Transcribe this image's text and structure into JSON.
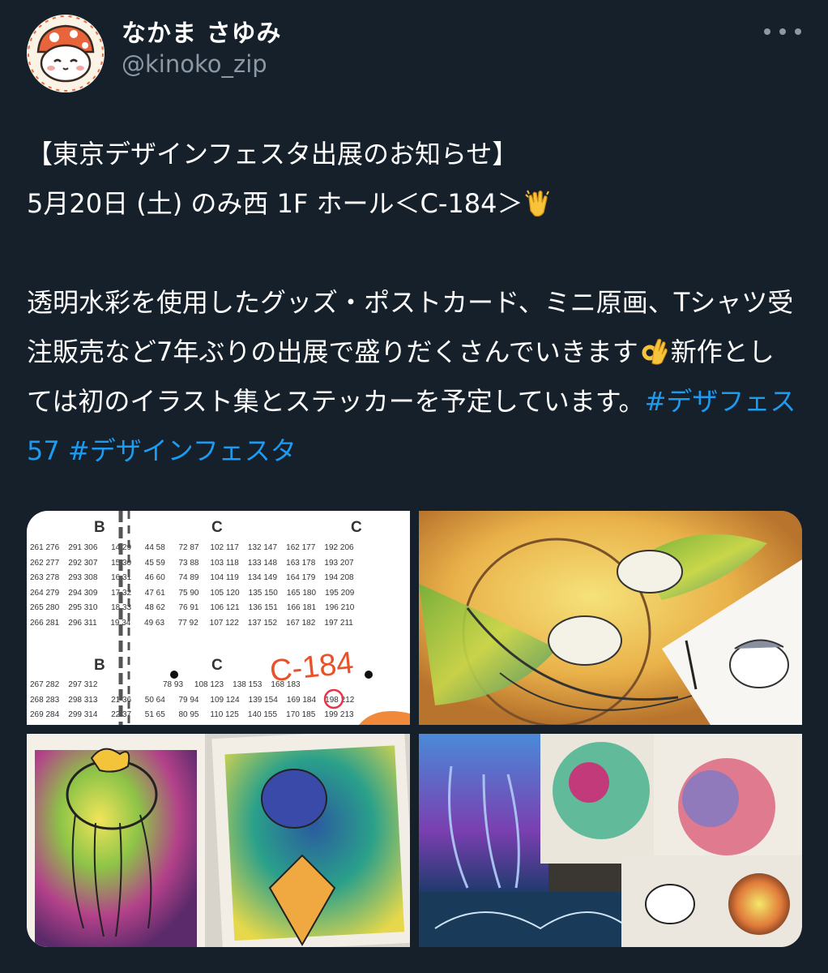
{
  "author": {
    "display_name": "なかま さゆみ",
    "handle": "@kinoko_zip",
    "avatar_icon": "mushroom-character-avatar"
  },
  "menu_icon": "more-options-icon",
  "tweet": {
    "line1": "【東京デザインフェスタ出展のお知らせ】",
    "line2": " 5月20日 (土) のみ西 1F ホール＜C-184＞",
    "line2_emoji": "clapping-hands-emoji",
    "para2_part1": "透明水彩を使用したグッズ・ポストカード、ミニ原画、Tシャツ受注販売など7年ぶりの出展で盛りだくさんでいきます",
    "para2_emoji": "ok-hand-emoji",
    "para2_part2": "新作としては初のイラスト集とステッカーを予定しています。",
    "hashtag1": "#デザフェス57",
    "hashtag2": "#デザインフェスタ"
  },
  "media": {
    "floor_map": {
      "section_labels": [
        "B",
        "C",
        "C",
        "B",
        "C"
      ],
      "booth_marker": "C-184",
      "rows_top": [
        "261 276    291 306      14 29      44 58      72 87     102 117    132 147    162 177    192 206",
        "262 277    292 307      15 30      45 59      73 88     103 118    133 148    163 178    193 207",
        "263 278    293 308      16 31      46 60      74 89     104 119    134 149    164 179    194 208",
        "264 279    294 309      17 32      47 61      75 90     105 120    135 150    165 180    195 209",
        "265 280    295 310      18 33      48 62      76 91     106 121    136 151    166 181    196 210",
        "266 281    296 311      19 34      49 63      77 92     107 122    137 152    167 182    197 211"
      ],
      "rows_bottom": [
        "267 282    297 312                             78 93     108 123    138 153    168 183",
        "268 283    298 313      21 36      50 64      79 94     109 124    139 154    169 184    198 212",
        "269 284    299 314      22 37      51 65      80 95     110 125    140 155    170 185    199 213"
      ]
    },
    "photo_birds_icon": "watercolor-birds-illustration",
    "photo_jellyfish_icon": "watercolor-jellyfish-postcards",
    "photo_collection_icon": "watercolor-postcard-collection"
  },
  "colors": {
    "background": "#15202b",
    "text": "#ffffff",
    "secondary": "#8b98a5",
    "hashtag": "#1d9bf0"
  }
}
